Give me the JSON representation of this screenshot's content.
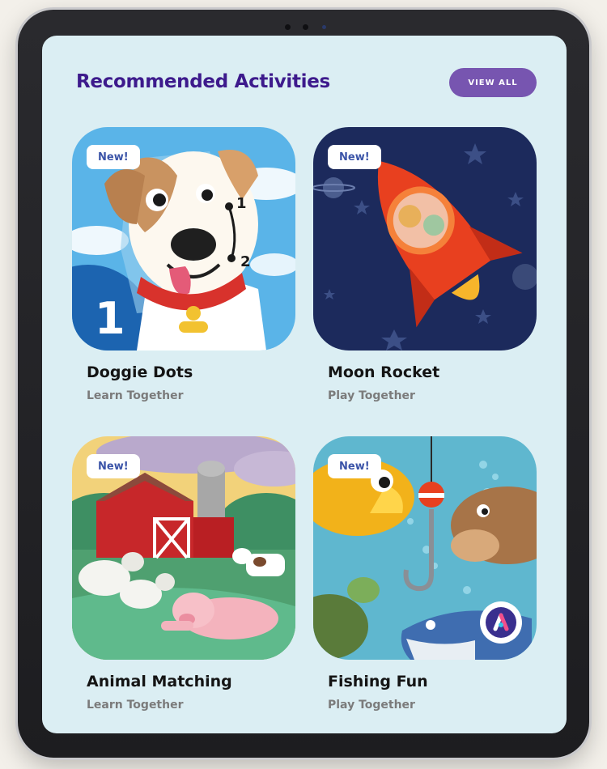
{
  "header": {
    "title": "Recommended Activities",
    "view_all_label": "VIEW ALL"
  },
  "activities": [
    {
      "title": "Doggie Dots",
      "subtitle": "Learn Together",
      "badge": "New!",
      "numbers": [
        "1",
        "2"
      ],
      "big_number": "1"
    },
    {
      "title": "Moon Rocket",
      "subtitle": "Play Together",
      "badge": "New!"
    },
    {
      "title": "Animal Matching",
      "subtitle": "Learn Together",
      "badge": "New!"
    },
    {
      "title": "Fishing Fun",
      "subtitle": "Play Together",
      "badge": "New!"
    }
  ],
  "colors": {
    "screen_background": "#dbeef3",
    "title": "#3d1a8c",
    "view_all_button": "#7755b0",
    "badge_text": "#3b54a8"
  }
}
